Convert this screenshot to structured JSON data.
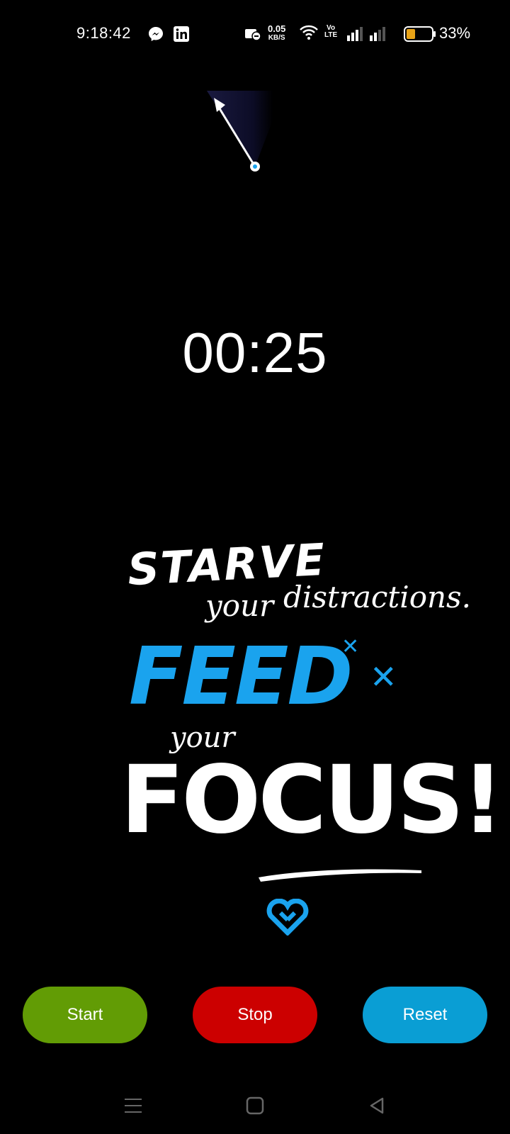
{
  "status_bar": {
    "time": "9:18:42",
    "net_speed_value": "0.05",
    "net_speed_unit": "KB/S",
    "volte_top": "Vo",
    "volte_bottom": "LTE",
    "battery_percent": "33%",
    "icons": [
      "messenger-icon",
      "linkedin-icon",
      "alarm-icon",
      "wifi-icon",
      "signal-icon",
      "battery-icon"
    ]
  },
  "timer": {
    "display": "00:25"
  },
  "quote": {
    "line1": "STARVE",
    "line2a": "your",
    "line2b": "distractions.",
    "line3": "FEED",
    "line4": "your",
    "line5": "FOCUS!",
    "accent_color": "#1aa3ee"
  },
  "buttons": {
    "start_label": "Start",
    "stop_label": "Stop",
    "reset_label": "Reset",
    "start_color": "#629c05",
    "stop_color": "#cc0000",
    "reset_color": "#0a9ed4"
  },
  "nav": {
    "icons": [
      "menu-icon",
      "home-icon",
      "back-icon"
    ]
  }
}
